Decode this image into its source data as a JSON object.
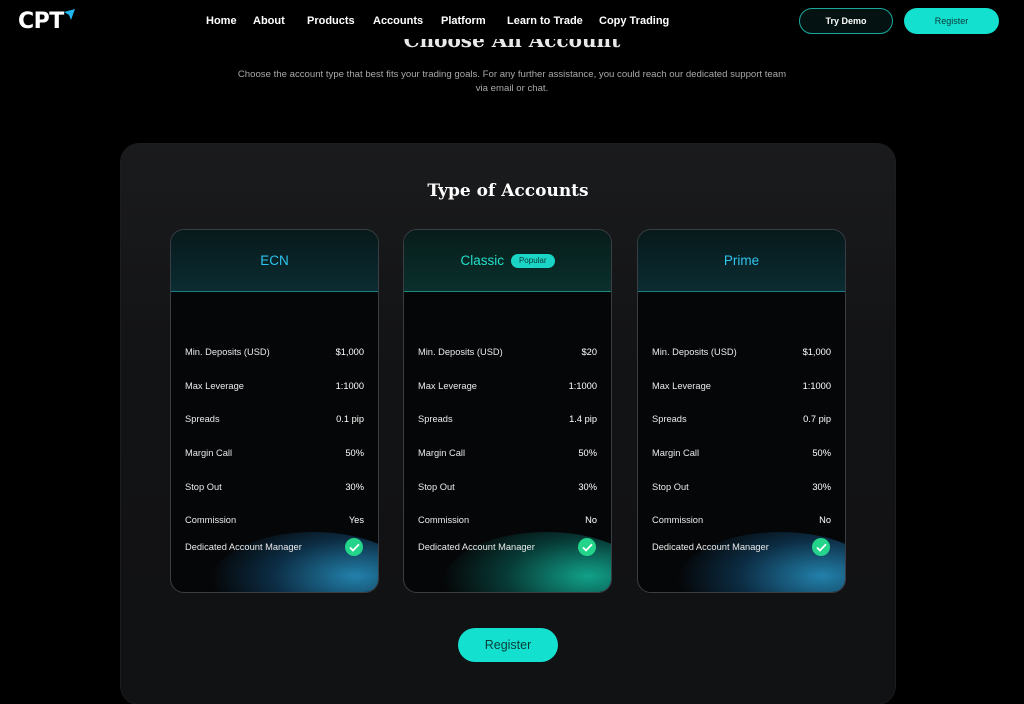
{
  "brand": {
    "name": "CPT"
  },
  "nav": {
    "items": [
      {
        "label": "Home"
      },
      {
        "label": "About"
      },
      {
        "label": "Products"
      },
      {
        "label": "Accounts"
      },
      {
        "label": "Platform"
      },
      {
        "label": "Learn to Trade"
      },
      {
        "label": "Copy Trading"
      }
    ],
    "try_demo": "Try Demo",
    "register": "Register"
  },
  "hero": {
    "title": "Choose An Account",
    "description": "Choose the account type that best fits your trading goals. For any further assistance, you could reach our dedicated support team via email or chat."
  },
  "panel": {
    "title": "Type of Accounts",
    "register": "Register"
  },
  "accounts": [
    {
      "name": "ECN",
      "badge": "",
      "rows": [
        {
          "label": "Min. Deposits (USD)",
          "value": "$1,000"
        },
        {
          "label": "Max Leverage",
          "value": "1:1000"
        },
        {
          "label": "Spreads",
          "value": "0.1 pip"
        },
        {
          "label": "Margin Call",
          "value": "50%"
        },
        {
          "label": "Stop Out",
          "value": "30%"
        },
        {
          "label": "Commission",
          "value": "Yes"
        },
        {
          "label": "Dedicated Account Manager",
          "value": "check-icon"
        }
      ]
    },
    {
      "name": "Classic",
      "badge": "Popular",
      "rows": [
        {
          "label": "Min. Deposits (USD)",
          "value": "$20"
        },
        {
          "label": "Max Leverage",
          "value": "1:1000"
        },
        {
          "label": "Spreads",
          "value": "1.4 pip"
        },
        {
          "label": "Margin Call",
          "value": "50%"
        },
        {
          "label": "Stop Out",
          "value": "30%"
        },
        {
          "label": "Commission",
          "value": "No"
        },
        {
          "label": "Dedicated Account Manager",
          "value": "check-icon"
        }
      ]
    },
    {
      "name": "Prime",
      "badge": "",
      "rows": [
        {
          "label": "Min. Deposits (USD)",
          "value": "$1,000"
        },
        {
          "label": "Max Leverage",
          "value": "1:1000"
        },
        {
          "label": "Spreads",
          "value": "0.7 pip"
        },
        {
          "label": "Margin Call",
          "value": "50%"
        },
        {
          "label": "Stop Out",
          "value": "30%"
        },
        {
          "label": "Commission",
          "value": "No"
        },
        {
          "label": "Dedicated Account Manager",
          "value": "check-icon"
        }
      ]
    }
  ],
  "colors": {
    "accent": "#14e0d0",
    "accent_blue": "#2fc4f0",
    "check_green": "#23d48a",
    "background": "#000000"
  }
}
